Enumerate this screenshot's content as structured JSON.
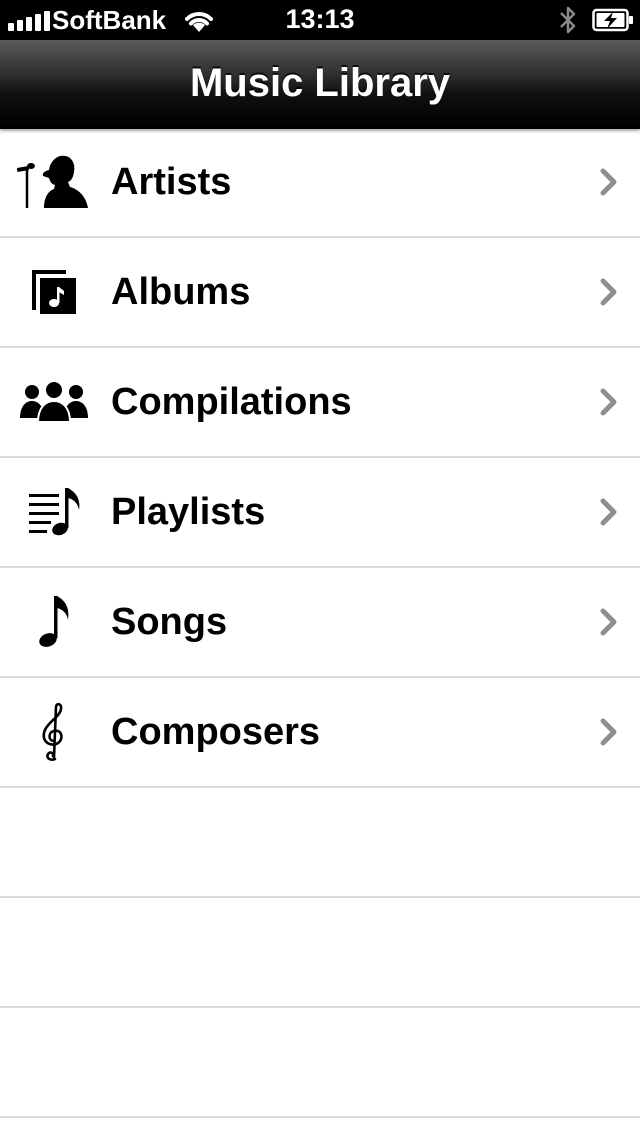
{
  "status_bar": {
    "carrier": "SoftBank",
    "time": "13:13",
    "signal_icon": "signal-bars-icon",
    "wifi_icon": "wifi-icon",
    "bluetooth_icon": "bluetooth-icon",
    "battery_icon": "battery-charging-icon"
  },
  "nav": {
    "title": "Music Library"
  },
  "list": {
    "items": [
      {
        "label": "Artists",
        "icon": "artist-microphone-icon"
      },
      {
        "label": "Albums",
        "icon": "album-icon"
      },
      {
        "label": "Compilations",
        "icon": "compilations-group-icon"
      },
      {
        "label": "Playlists",
        "icon": "playlist-icon"
      },
      {
        "label": "Songs",
        "icon": "music-note-icon"
      },
      {
        "label": "Composers",
        "icon": "treble-clef-icon"
      }
    ]
  },
  "colors": {
    "status_bar_bg": "#000000",
    "nav_bar_bg": "#1a1a1a",
    "separator": "#d9d9d9",
    "chevron": "#8e8e8e"
  }
}
